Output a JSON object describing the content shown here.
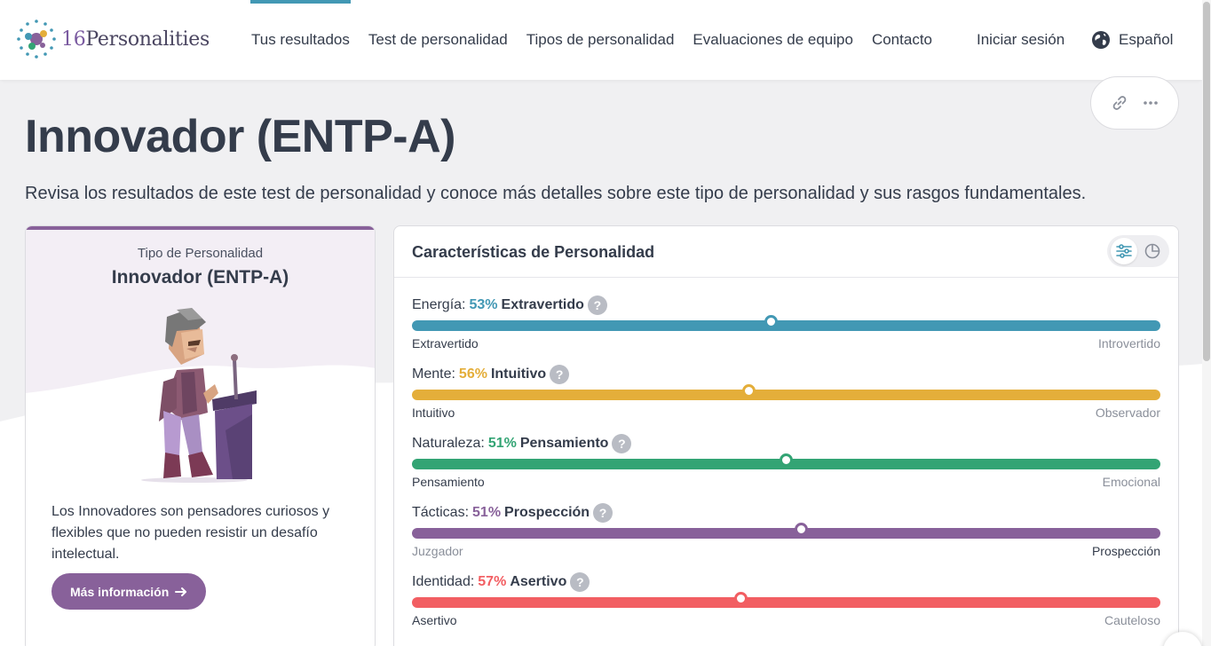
{
  "brand": {
    "logo_text_num": "16",
    "logo_text_word": "Personalities"
  },
  "nav": {
    "items": [
      "Tus resultados",
      "Test de personalidad",
      "Tipos de personalidad",
      "Evaluaciones de equipo",
      "Contacto"
    ],
    "active_index": 0,
    "login": "Iniciar sesión",
    "language": "Español"
  },
  "page": {
    "title": "Innovador (ENTP-A)",
    "subtitle": "Revisa los resultados de este test de personalidad y conoce más detalles sobre este tipo de personalidad y sus rasgos fundamentales."
  },
  "icons": {
    "share": "link-icon",
    "more": "more-horizontal-icon",
    "sliders": "sliders-icon",
    "pie": "pie-chart-icon",
    "globe": "globe-icon",
    "arrow": "arrow-right-icon"
  },
  "type_card": {
    "label": "Tipo de Personalidad",
    "name": "Innovador (ENTP-A)",
    "description": "Los Innovadores son pensadores curiosos y flexibles que no pueden resistir un desafío intelectual.",
    "button": "Más información",
    "accent": "#88619a"
  },
  "traits": {
    "title": "Características de Personalidad",
    "items": [
      {
        "label": "Energía:",
        "percent": "53%",
        "trait": "Extravertido",
        "value": 0.47,
        "left": "Extravertido",
        "right": "Introvertido",
        "active": "left",
        "color": "#4298b4"
      },
      {
        "label": "Mente:",
        "percent": "56%",
        "trait": "Intuitivo",
        "value": 0.44,
        "left": "Intuitivo",
        "right": "Observador",
        "active": "left",
        "color": "#e4ae3a"
      },
      {
        "label": "Naturaleza:",
        "percent": "51%",
        "trait": "Pensamiento",
        "value": 0.49,
        "left": "Pensamiento",
        "right": "Emocional",
        "active": "left",
        "color": "#33a474"
      },
      {
        "label": "Tácticas:",
        "percent": "51%",
        "trait": "Prospección",
        "value": 0.51,
        "left": "Juzgador",
        "right": "Prospección",
        "active": "right",
        "color": "#88619a"
      },
      {
        "label": "Identidad:",
        "percent": "57%",
        "trait": "Asertivo",
        "value": 0.43,
        "left": "Asertivo",
        "right": "Cauteloso",
        "active": "left",
        "color": "#f25e62"
      }
    ]
  }
}
